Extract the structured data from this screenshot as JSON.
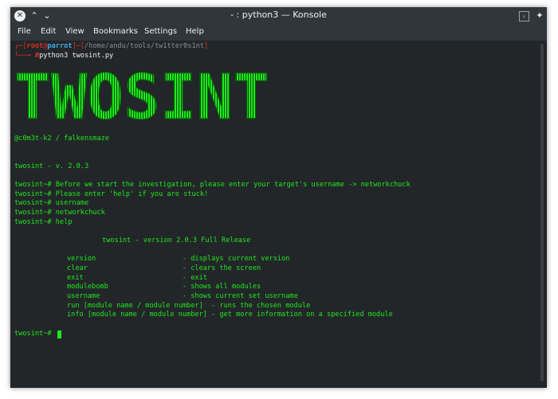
{
  "titlebar": {
    "title": "- : python3 — Konsole"
  },
  "menu": [
    "File",
    "Edit",
    "View",
    "Bookmarks",
    "Settings",
    "Help"
  ],
  "prompt": {
    "open": "┌─[",
    "user": "root",
    "at": "@",
    "host": "parrot",
    "mid": "]─[",
    "path": "/home/andu/tools/tw1tter0s1nt",
    "close": "]",
    "arrow": "└──╼ ",
    "hash": "#",
    "command": "python3 twosint.py"
  },
  "banner": {
    "logo_text": "TWOSINT",
    "credit": "@c0m3t-k2 / falkensmaze",
    "version": "twosint - v. 2.0.3"
  },
  "session": [
    "twosint~# Before we start the investigation, please enter your target's username -> networkchuck",
    "twosint~# Please enter 'help' if you are stuck!",
    "twosint~# username",
    "twosint~# networkchuck",
    "twosint~# help"
  ],
  "help": {
    "heading": "twosint - version 2.0.3 Full Release",
    "commands": [
      "version                     - displays current version",
      "clear                       - clears the screen",
      "exit                        - exit",
      "modulebomb                  - shows all modules",
      "username                    - shows current set username",
      "run [module name / module number]  - runs the chosen module",
      "info [module name / module number] - get more information on a specified module"
    ]
  },
  "current_prompt": "twosint~# "
}
